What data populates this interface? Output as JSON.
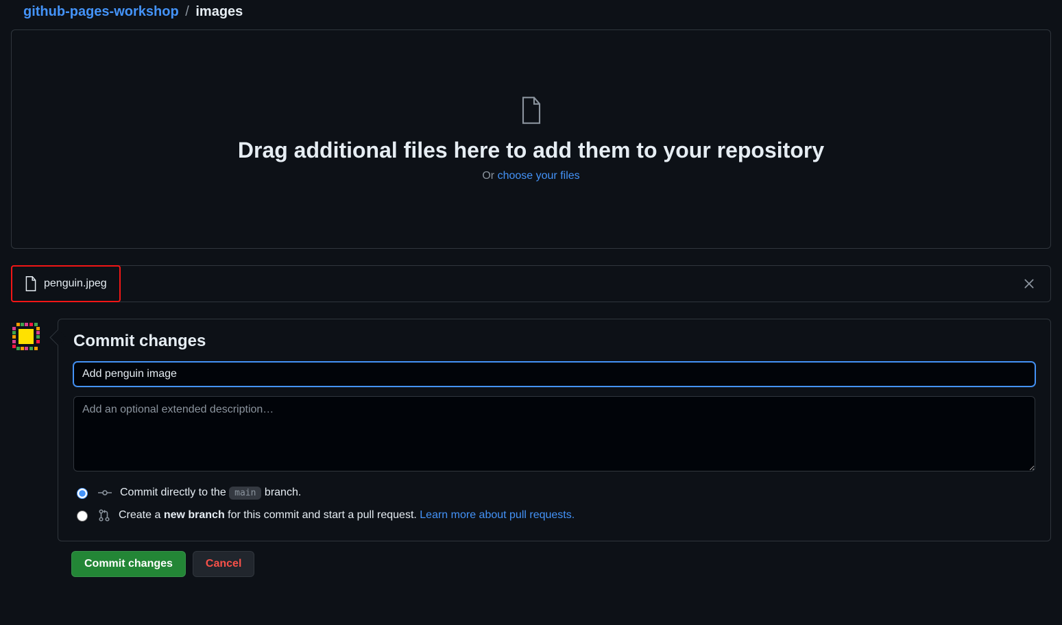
{
  "breadcrumb": {
    "repo": "github-pages-workshop",
    "current": "images"
  },
  "dropzone": {
    "heading": "Drag additional files here to add them to your repository",
    "or_prefix": "Or ",
    "choose_link": "choose your files"
  },
  "file": {
    "name": "penguin.jpeg"
  },
  "commit": {
    "heading": "Commit changes",
    "summary_value": "Add penguin image",
    "description_placeholder": "Add an optional extended description…",
    "direct_prefix": "Commit directly to the ",
    "direct_branch": "main",
    "direct_suffix": " branch.",
    "new_branch_prefix": "Create a ",
    "new_branch_bold": "new branch",
    "new_branch_mid": " for this commit and start a pull request. ",
    "learn_more": "Learn more about pull requests.",
    "submit_label": "Commit changes",
    "cancel_label": "Cancel"
  }
}
